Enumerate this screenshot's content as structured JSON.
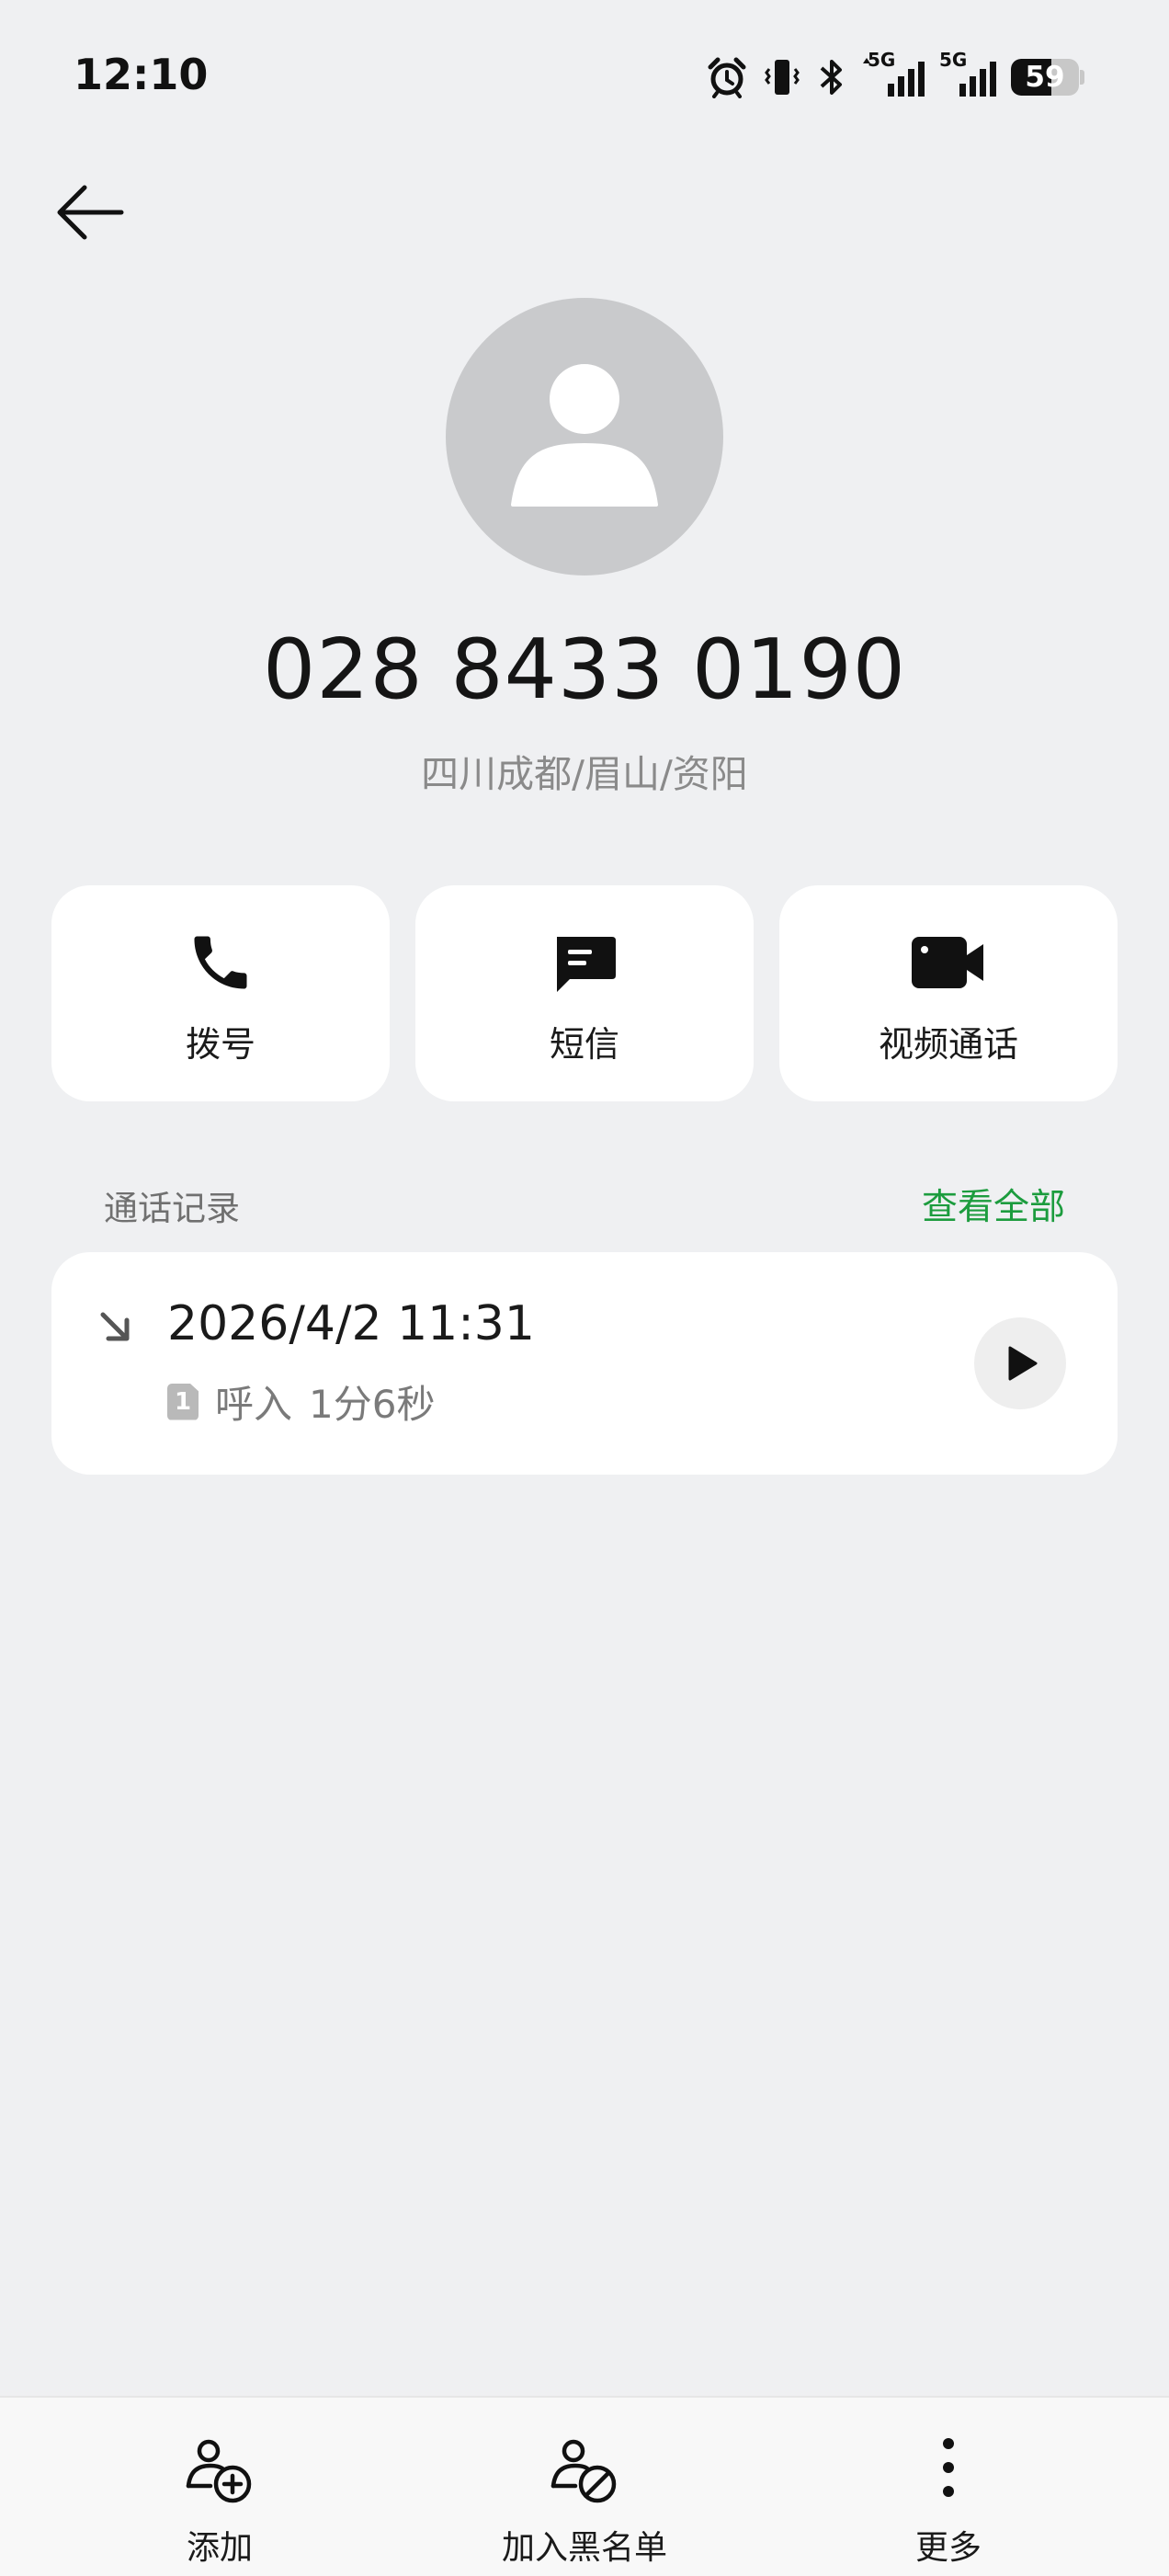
{
  "status_bar": {
    "time": "12:10",
    "battery_level": "59",
    "battery_fraction": 0.59,
    "network_1": "5G",
    "network_2": "5G",
    "icons": [
      "alarm-icon",
      "vibrate-icon",
      "bluetooth-icon",
      "signal-icon",
      "signal-icon",
      "battery-icon"
    ]
  },
  "header": {
    "back_icon": "back-arrow-icon"
  },
  "contact": {
    "phone_number": "028 8433 0190",
    "location": "四川成都/眉山/资阳",
    "avatar_icon": "person-icon"
  },
  "actions": [
    {
      "label": "拨号",
      "icon": "phone-icon"
    },
    {
      "label": "短信",
      "icon": "message-icon"
    },
    {
      "label": "视频通话",
      "icon": "video-call-icon"
    }
  ],
  "call_log": {
    "title": "通话记录",
    "view_all": "查看全部",
    "entries": [
      {
        "datetime": "2026/4/2 11:31",
        "sim": "1",
        "type": "呼入",
        "duration": "1分6秒",
        "direction_icon": "incoming-arrow-icon",
        "action_icon": "play-icon"
      }
    ]
  },
  "bottom_bar": {
    "items": [
      {
        "label": "添加",
        "icon": "add-contact-icon"
      },
      {
        "label": "加入黑名单",
        "icon": "block-contact-icon"
      },
      {
        "label": "更多",
        "icon": "more-vertical-icon"
      }
    ]
  },
  "colors": {
    "background": "#eff0f2",
    "card": "#ffffff",
    "accent_green": "#1c9c3e",
    "avatar_bg": "#c9cacc"
  }
}
